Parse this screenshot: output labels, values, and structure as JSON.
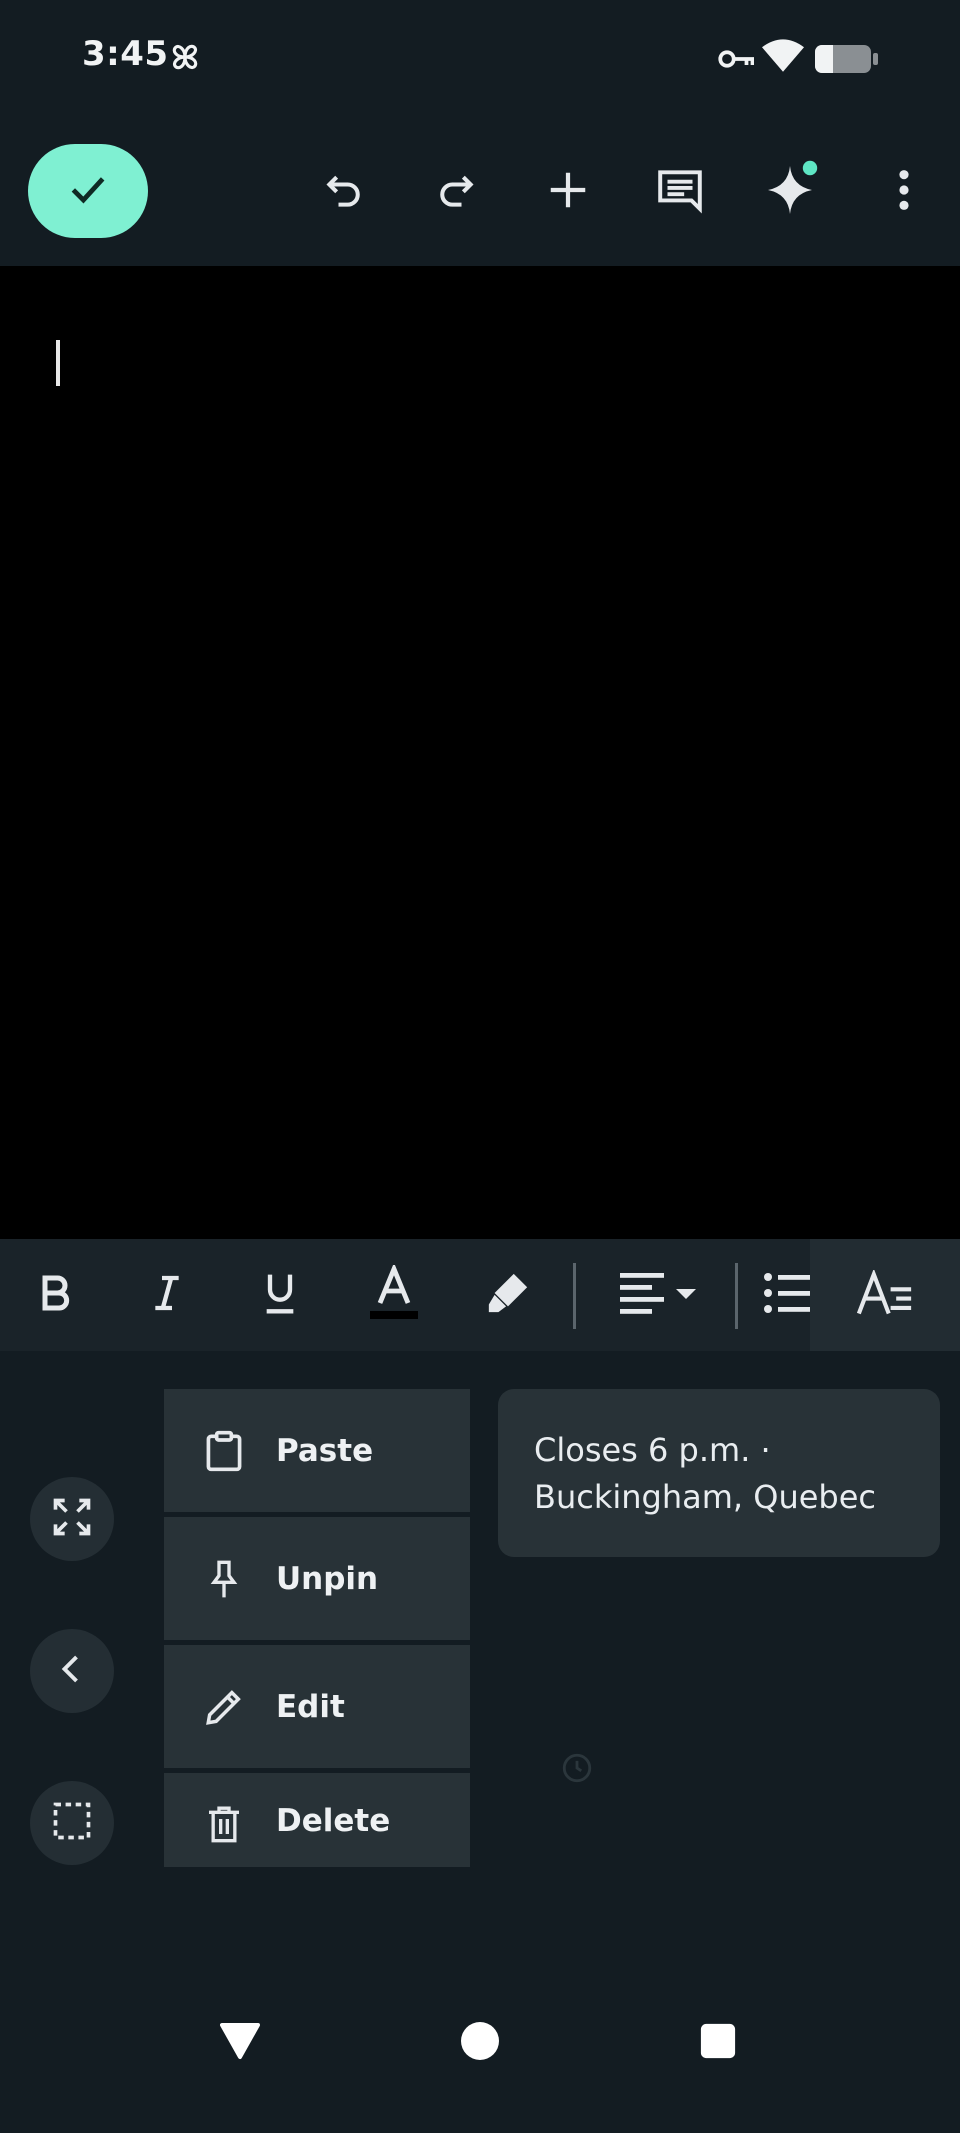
{
  "status_bar": {
    "time": "3:45",
    "icons": [
      "pinwheel-icon",
      "vpn-key-icon",
      "wifi-icon",
      "battery-icon"
    ]
  },
  "app_bar": {
    "actions": [
      "done-check-icon",
      "undo-icon",
      "redo-icon",
      "add-icon",
      "comment-icon",
      "gemini-sparkle-icon",
      "more-vert-icon"
    ]
  },
  "format_toolbar": {
    "buttons": [
      "bold-icon",
      "italic-icon",
      "underline-icon",
      "text-color-icon",
      "highlight-icon",
      "align-icon",
      "bulleted-list-icon",
      "text-style-icon"
    ]
  },
  "clipboard": {
    "menu": [
      {
        "icon": "clipboard-icon",
        "label": "Paste"
      },
      {
        "icon": "pin-icon",
        "label": "Unpin"
      },
      {
        "icon": "pencil-icon",
        "label": "Edit"
      },
      {
        "icon": "trash-icon",
        "label": "Delete"
      }
    ],
    "clip_card_text": "Closes 6 p.m. · Buckingham, Quebec",
    "side_buttons": [
      "expand-icon",
      "back-chevron-icon",
      "select-icon"
    ]
  },
  "colors": {
    "accent": "#7ff0d2",
    "bar_bg": "#131c22",
    "menu_bg": "#283237",
    "sparkle_dot": "#5ee6c4"
  }
}
